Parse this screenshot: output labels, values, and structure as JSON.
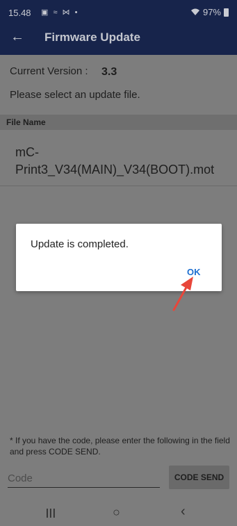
{
  "status_bar": {
    "time": "15.48",
    "notification_icons": "▣ ≈ ⋈ •",
    "wifi_icon": "wifi-icon",
    "battery_percent": "97%"
  },
  "header": {
    "title": "Firmware Update",
    "back_icon": "back-arrow-icon"
  },
  "main": {
    "current_version_label": "Current Version :",
    "current_version_value": "3.3",
    "instruction": "Please select an update file.",
    "file_name_header": "File Name",
    "file_name": "mC-Print3_V34(MAIN)_V34(BOOT).mot"
  },
  "dialog": {
    "message": "Update is completed.",
    "ok_label": "OK"
  },
  "footer": {
    "note": "* If you have the code, please enter the following in the field and press CODE SEND.",
    "code_placeholder": "Code",
    "code_send_label": "CODE SEND"
  },
  "nav": {
    "recents_glyph": "|||",
    "home_glyph": "○",
    "back_glyph": "‹"
  },
  "colors": {
    "app_bar": "#17244b",
    "overlay_bg": "#7d7d7d",
    "accent_ok": "#1e6fd0",
    "annotation_arrow": "#e8463a"
  }
}
